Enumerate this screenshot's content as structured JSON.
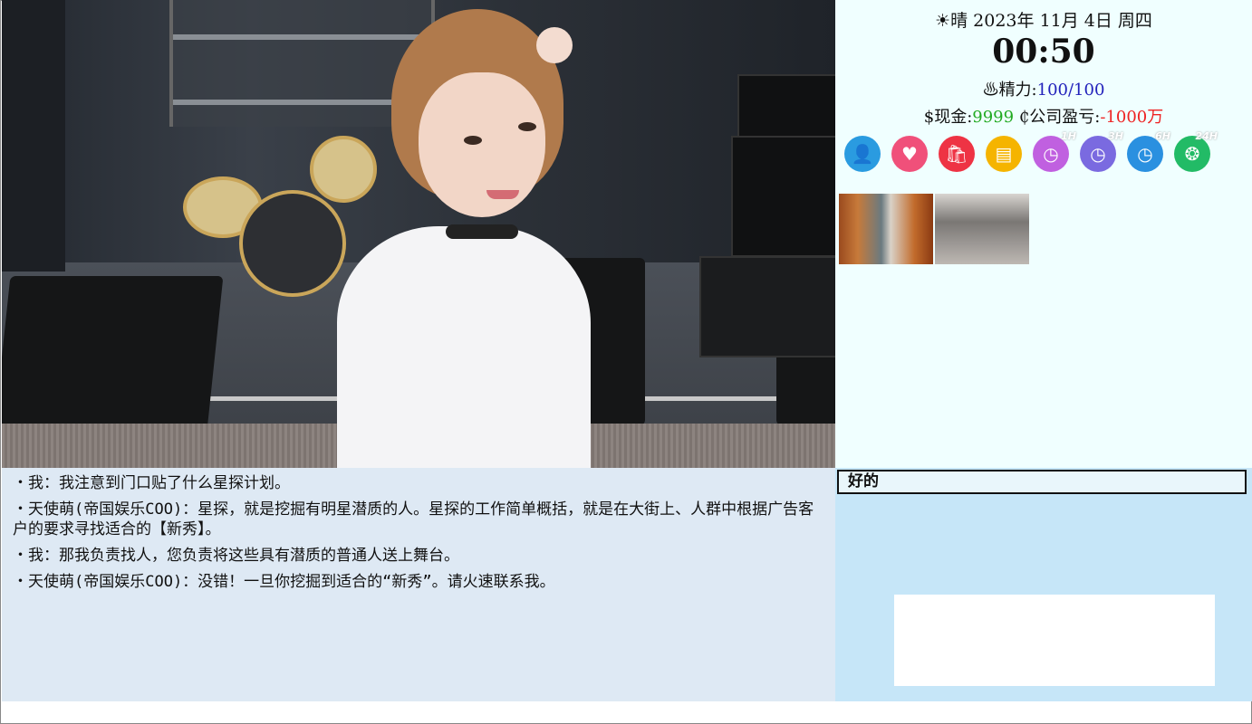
{
  "status": {
    "weather_icon": "sun-icon",
    "weather": "晴",
    "date": "2023年 11月 4日 周四",
    "time": "00:50",
    "energy_label": "精力:",
    "energy_value": "100/100",
    "cash_label": "现金:",
    "cash_value": "9999",
    "company_label": "公司盈亏:",
    "company_value": "-1000万",
    "icons": [
      {
        "name": "contacts-icon",
        "color": "#2a9be0"
      },
      {
        "name": "favorite-heart-icon",
        "color": "#f0507a"
      },
      {
        "name": "shop-bag-icon",
        "color": "#ee3344"
      },
      {
        "name": "save-icon",
        "color": "#f5b400"
      },
      {
        "name": "wait-1h-icon",
        "color": "#c060e0",
        "tag": "1H"
      },
      {
        "name": "wait-3h-icon",
        "color": "#7a6ae0",
        "tag": "3H"
      },
      {
        "name": "wait-6h-icon",
        "color": "#2a90e0",
        "tag": "6H"
      },
      {
        "name": "wait-24h-icon",
        "color": "#22bb66",
        "tag": "24H"
      }
    ]
  },
  "dialogue": [
    "・我：我注意到门口贴了什么星探计划。",
    "・天使萌(帝国娱乐COO)：星探，就是挖掘有明星潜质的人。星探的工作简单概括，就是在大街上、人群中根据广告客户的要求寻找适合的【新秀】。",
    "・我：那我负责找人，您负责将这些具有潜质的普通人送上舞台。",
    "・天使萌(帝国娱乐COO)：没错！一旦你挖掘到适合的“新秀”。请火速联系我。"
  ],
  "choices": {
    "option1": "好的"
  }
}
